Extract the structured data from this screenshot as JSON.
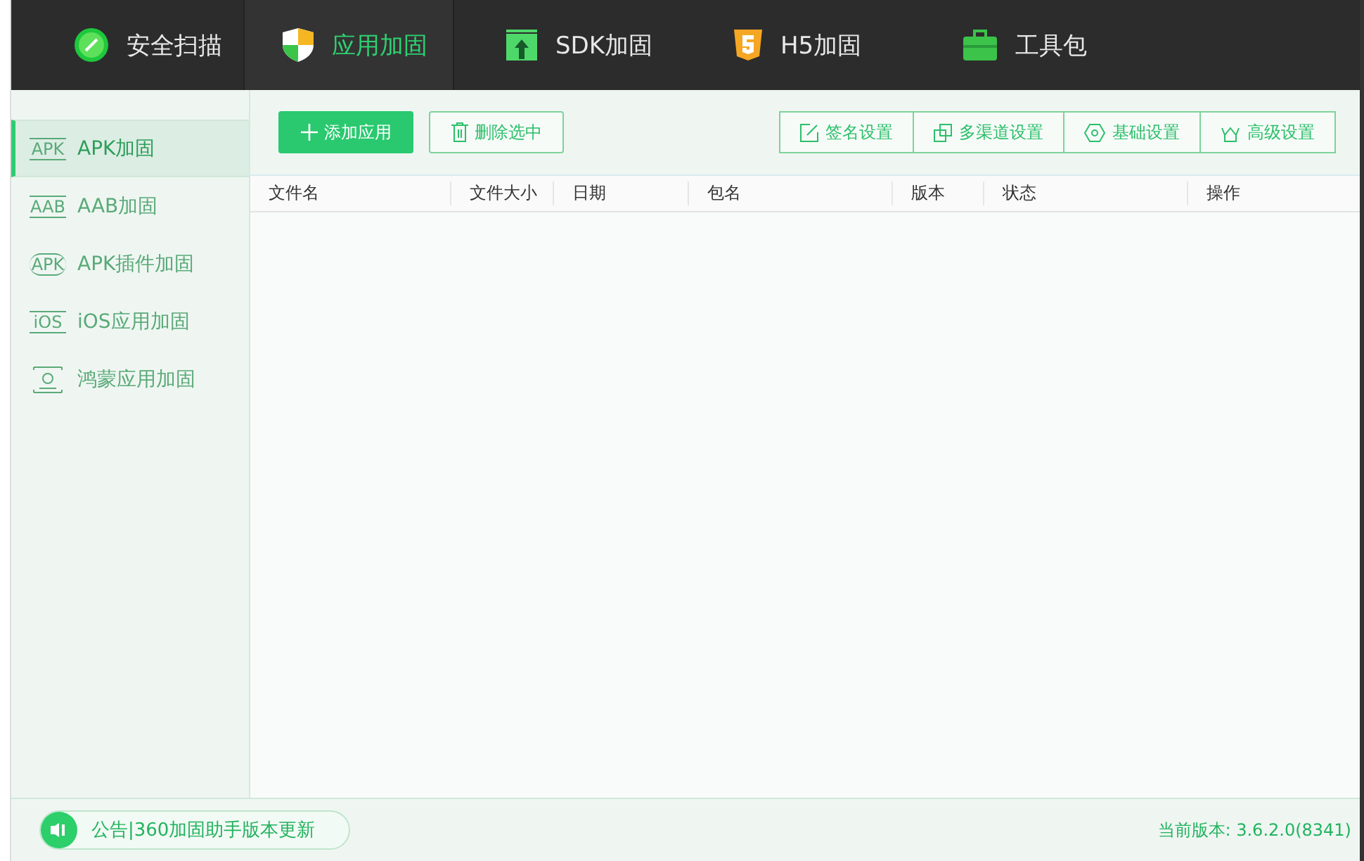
{
  "tabs": [
    {
      "label": "安全扫描",
      "selected": false
    },
    {
      "label": "应用加固",
      "selected": true
    },
    {
      "label": "SDK加固",
      "selected": false
    },
    {
      "label": "H5加固",
      "selected": false
    },
    {
      "label": "工具包",
      "selected": false
    }
  ],
  "sidebar": {
    "items": [
      {
        "label": "APK加固",
        "badge": "APK",
        "kind": "bracket",
        "selected": true
      },
      {
        "label": "AAB加固",
        "badge": "AAB",
        "kind": "bracket",
        "selected": false
      },
      {
        "label": "APK插件加固",
        "badge": "APK",
        "kind": "arc",
        "selected": false
      },
      {
        "label": "iOS应用加固",
        "badge": "iOS",
        "kind": "bracket",
        "selected": false
      },
      {
        "label": "鸿蒙应用加固",
        "kind": "drawing",
        "selected": false
      }
    ]
  },
  "toolbar": {
    "left_buttons": [
      {
        "label": "添加应用",
        "kind": "primary"
      },
      {
        "label": "删除选中",
        "kind": "outline"
      }
    ],
    "right_buttons": [
      {
        "label": "签名设置"
      },
      {
        "label": "多渠道设置"
      },
      {
        "label": "基础设置"
      },
      {
        "label": "高级设置"
      }
    ]
  },
  "table": {
    "columns": [
      "文件名",
      "文件大小",
      "日期",
      "包名",
      "版本",
      "状态",
      "操作"
    ]
  },
  "status_bar": {
    "notice": "公告|360加固助手版本更新",
    "version": "当前版本: 3.6.2.0(8341)"
  }
}
